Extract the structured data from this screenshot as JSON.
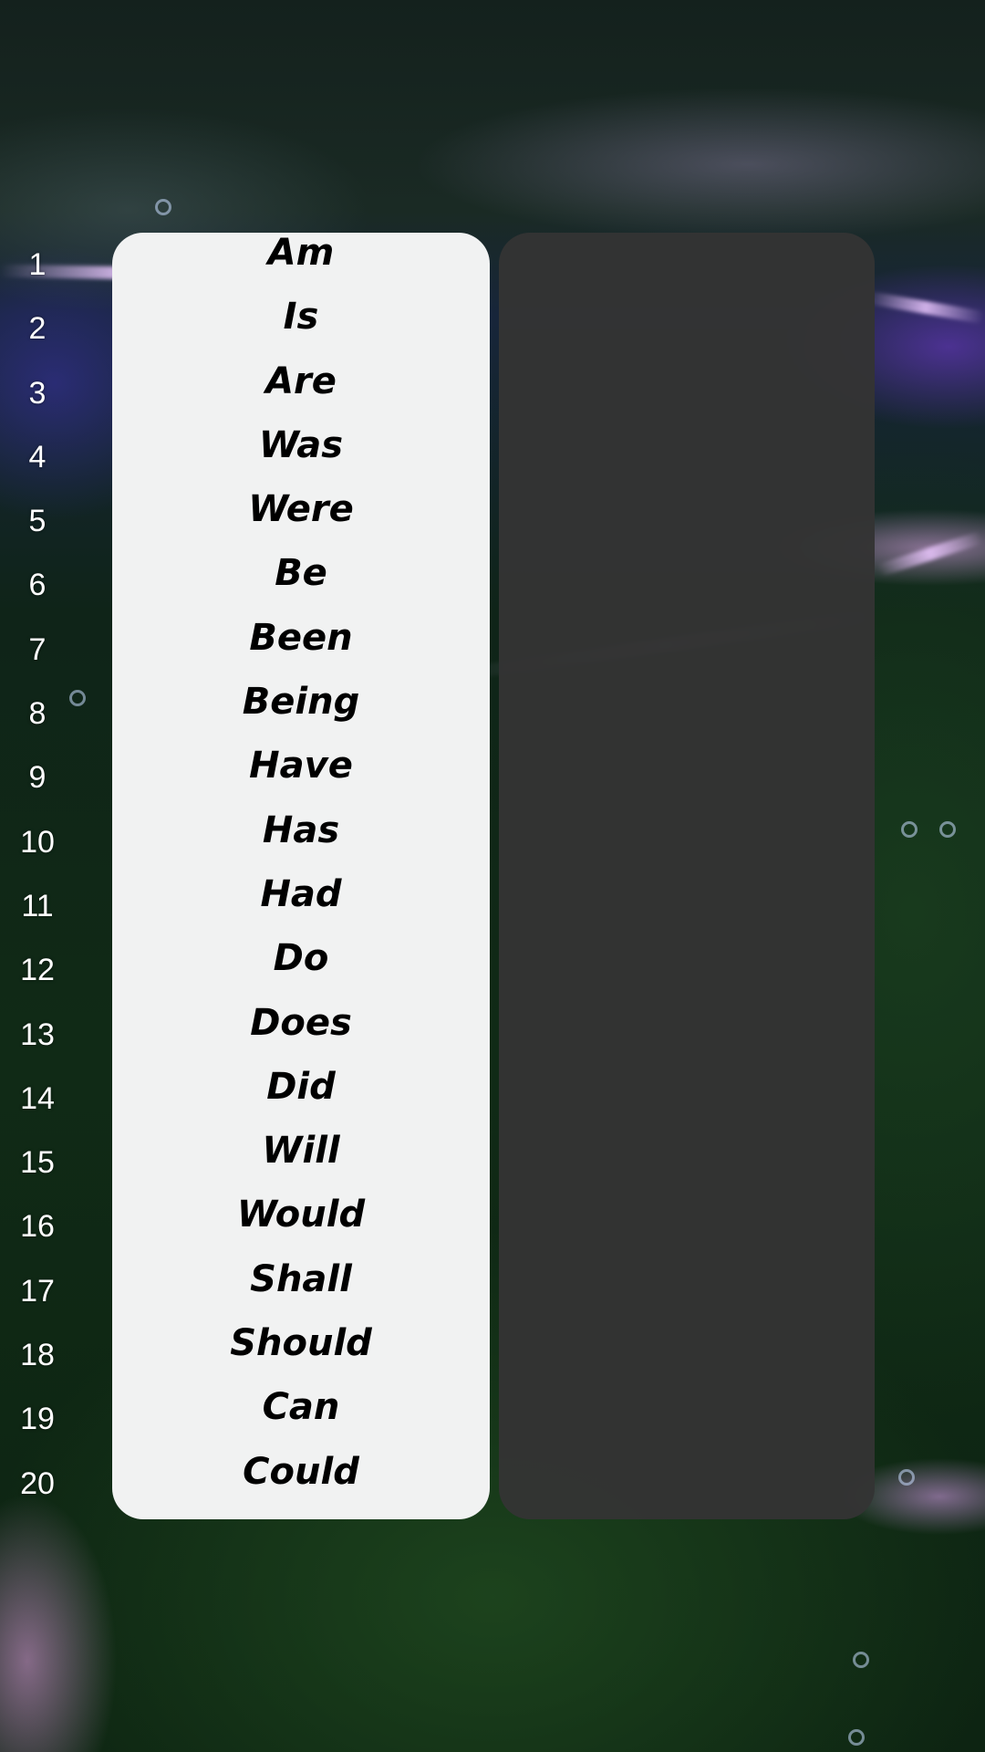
{
  "numbers": [
    "1",
    "2",
    "3",
    "4",
    "5",
    "6",
    "7",
    "8",
    "9",
    "10",
    "11",
    "12",
    "13",
    "14",
    "15",
    "16",
    "17",
    "18",
    "19",
    "20"
  ],
  "words": [
    "Am",
    "Is",
    "Are",
    "Was",
    "Were",
    "Be",
    "Been",
    "Being",
    "Have",
    "Has",
    "Had",
    "Do",
    "Does",
    "Did",
    "Will",
    "Would",
    "Shall",
    "Should",
    "Can",
    "Could"
  ],
  "colors": {
    "word_card_bg": "#f1f2f2",
    "answer_card_bg": "#343434",
    "number_text": "#ffffff",
    "word_text": "#000000"
  }
}
